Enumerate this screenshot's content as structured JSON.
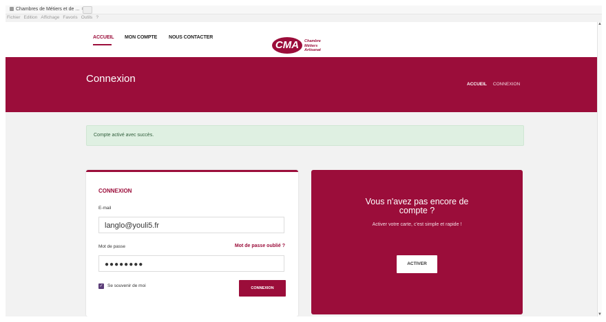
{
  "browser": {
    "tab_title": "Chambres de Métiers et de ...",
    "tab_close": "×",
    "menu": [
      "Fichier",
      "Edition",
      "Affichage",
      "Favoris",
      "Outils",
      "?"
    ]
  },
  "nav": {
    "items": [
      "ACCUEIL",
      "MON COMPTE",
      "NOUS CONTACTER"
    ],
    "active": "ACCUEIL"
  },
  "logo": {
    "mark": "CMA",
    "line1": "Chambre",
    "line2": "Métiers",
    "line3": "Artisanat"
  },
  "hero": {
    "title": "Connexion",
    "breadcrumb": [
      "ACCUEIL",
      "CONNEXION"
    ]
  },
  "alert": {
    "text": "Compte activé avec succès."
  },
  "login": {
    "title": "CONNEXION",
    "email_label": "E-mail",
    "email_value": "langlo@youli5.fr",
    "password_label": "Mot de passe",
    "forgot_link": "Mot de passe oublié ?",
    "password_masked": "●●●●●●●●",
    "remember_label": "Se souvenir de moi",
    "remember_checked": true,
    "submit_label": "CONNEXION"
  },
  "promo": {
    "title_line1": "Vous n'avez pas encore de",
    "title_line2": "compte ?",
    "subtitle": "Activer votre carte, c'est simple et rapide !",
    "button_label": "ACTIVER"
  },
  "colors": {
    "brand": "#9b0d3a",
    "success_bg": "#dff0e2",
    "page_bg": "#f2f2f2"
  }
}
